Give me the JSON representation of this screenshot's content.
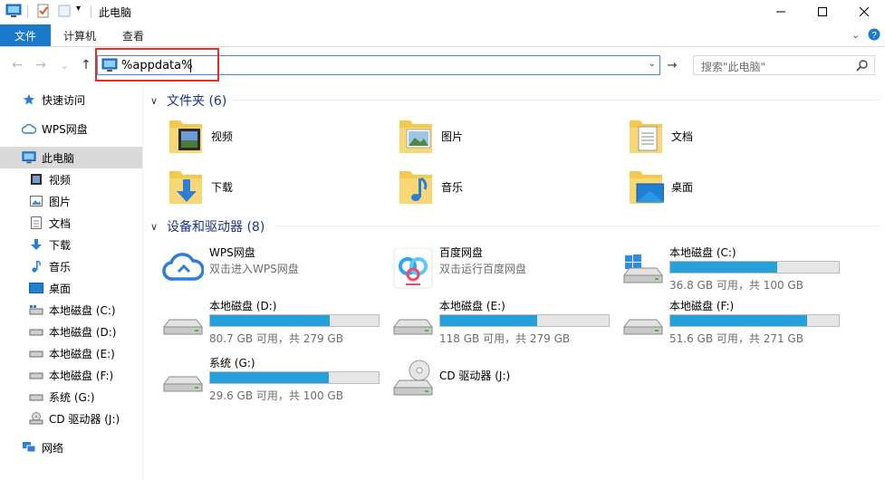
{
  "window": {
    "title": "此电脑",
    "controls": {
      "minimize": "—",
      "maximize": "☐",
      "close": "✕"
    }
  },
  "ribbon": {
    "tabs": [
      {
        "label": "文件"
      },
      {
        "label": "计算机"
      },
      {
        "label": "查看"
      }
    ]
  },
  "nav": {
    "back": "←",
    "forward": "→",
    "recent": "⌄",
    "up": "↑"
  },
  "address": {
    "value": "%appdata%",
    "go": "→"
  },
  "search": {
    "placeholder": "搜索\"此电脑\""
  },
  "sidebar": {
    "items": [
      {
        "label": "快速访问",
        "icon": "star-icon"
      },
      {
        "label": "WPS网盘",
        "icon": "cloud-icon"
      },
      {
        "label": "此电脑",
        "icon": "computer-icon",
        "selected": true
      },
      {
        "label": "视频",
        "icon": "video-icon"
      },
      {
        "label": "图片",
        "icon": "picture-icon"
      },
      {
        "label": "文档",
        "icon": "document-icon"
      },
      {
        "label": "下载",
        "icon": "download-icon"
      },
      {
        "label": "音乐",
        "icon": "music-icon"
      },
      {
        "label": "桌面",
        "icon": "desktop-icon"
      },
      {
        "label": "本地磁盘 (C:)",
        "icon": "drive-icon"
      },
      {
        "label": "本地磁盘 (D:)",
        "icon": "drive-icon"
      },
      {
        "label": "本地磁盘 (E:)",
        "icon": "drive-icon"
      },
      {
        "label": "本地磁盘 (F:)",
        "icon": "drive-icon"
      },
      {
        "label": "系统 (G:)",
        "icon": "drive-icon"
      },
      {
        "label": "CD 驱动器 (J:)",
        "icon": "cd-drive-icon"
      },
      {
        "label": "网络",
        "icon": "network-icon"
      }
    ]
  },
  "folders": {
    "header": "文件夹 (6)",
    "items": [
      {
        "label": "视频",
        "icon": "video-folder-icon"
      },
      {
        "label": "图片",
        "icon": "picture-folder-icon"
      },
      {
        "label": "文档",
        "icon": "document-folder-icon"
      },
      {
        "label": "下载",
        "icon": "download-folder-icon"
      },
      {
        "label": "音乐",
        "icon": "music-folder-icon"
      },
      {
        "label": "桌面",
        "icon": "desktop-folder-icon"
      }
    ]
  },
  "devices": {
    "header": "设备和驱动器 (8)",
    "items": [
      {
        "name": "WPS网盘",
        "subtitle": "双击进入WPS网盘",
        "icon": "wps-cloud-icon"
      },
      {
        "name": "百度网盘",
        "subtitle": "双击运行百度网盘",
        "icon": "baidu-netdisk-icon"
      },
      {
        "name": "本地磁盘 (C:)",
        "free": "36.8 GB 可用，共 100 GB",
        "used_fraction": 0.632,
        "icon": "windows-drive-icon"
      },
      {
        "name": "本地磁盘 (D:)",
        "free": "80.7 GB 可用，共 279 GB",
        "used_fraction": 0.711,
        "icon": "drive-icon"
      },
      {
        "name": "本地磁盘 (E:)",
        "free": "118 GB 可用，共 279 GB",
        "used_fraction": 0.577,
        "icon": "drive-icon"
      },
      {
        "name": "本地磁盘 (F:)",
        "free": "51.6 GB 可用，共 271 GB",
        "used_fraction": 0.81,
        "icon": "drive-icon"
      },
      {
        "name": "系统 (G:)",
        "free": "29.6 GB 可用，共 100 GB",
        "used_fraction": 0.704,
        "icon": "drive-icon"
      },
      {
        "name": "CD 驱动器 (J:)",
        "icon": "cd-drive-icon"
      }
    ]
  },
  "colors": {
    "accent": "#1979ca",
    "bar_fill": "#26a0da",
    "highlight": "#e0312a",
    "header_text": "#1e3287"
  }
}
